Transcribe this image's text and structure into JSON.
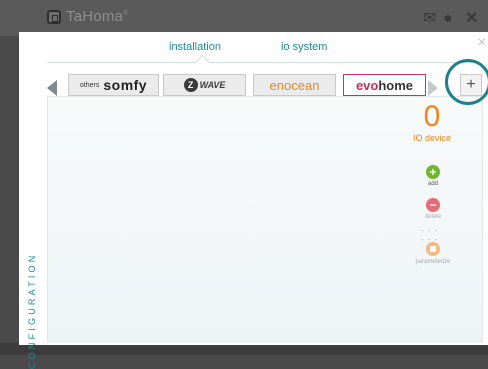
{
  "app": {
    "title": "TaHoma",
    "title_mark": "®"
  },
  "tabs": [
    {
      "label": "installation"
    },
    {
      "label": "io system"
    }
  ],
  "close_label": "×",
  "brands": {
    "somfy_prefix": "others",
    "somfy": "somfy",
    "zwave_logo": "Z",
    "zwave": "WAVE",
    "enocean": "enocean",
    "evo_part1": "evo",
    "evo_part2": "home"
  },
  "add_brand_label": "+",
  "side_label": "CONFIGURATION",
  "device_count": "0",
  "device_count_label": "IO device",
  "actions": {
    "add": "add",
    "delete": "delete",
    "separator": "- - - - - -",
    "parameterize": "parameterize"
  },
  "colors": {
    "accent": "#1a8c9e",
    "count": "#f0841e",
    "add": "#6fb72f",
    "delete": "#e86b78",
    "param": "#f5b97c",
    "evohome": "#c8305a"
  },
  "icons": [
    "home-icon",
    "mail-icon",
    "user-icon",
    "close-icon",
    "chevron-left-icon",
    "chevron-right-icon",
    "plus-icon",
    "add-icon",
    "delete-icon",
    "parameterize-icon"
  ]
}
